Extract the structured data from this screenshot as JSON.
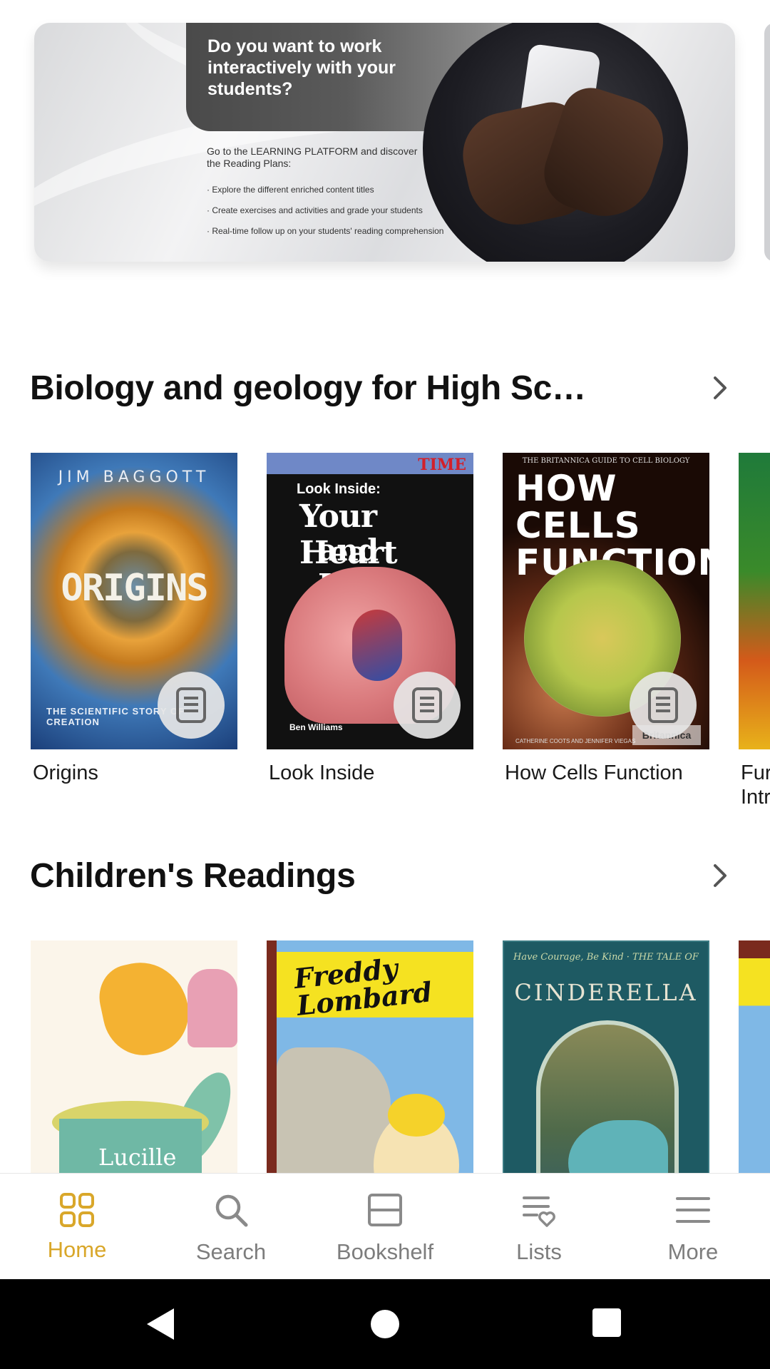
{
  "banner": {
    "headline": "Do you want to work interactively with your students?",
    "subtitle": "Go to the LEARNING PLATFORM and discover the Reading Plans:",
    "bullets": [
      "· Explore the different enriched content titles",
      "· Create exercises and activities and grade your students",
      "· Real-time follow up on your students' reading comprehension"
    ]
  },
  "sections": [
    {
      "title": "Biology and geology for High Sc…",
      "books": [
        {
          "label": "Origins",
          "cover": {
            "author": "JIM BAGGOTT",
            "title": "ORIGINS",
            "subtitle": "THE SCIENTIFIC STORY OF CREATION"
          }
        },
        {
          "label": "Look Inside",
          "cover": {
            "brand": "TIME",
            "kicker": "Look Inside:",
            "title_line1": "Your Heart",
            "title_line2": "and Lungs",
            "author": "Ben Williams"
          }
        },
        {
          "label": "How Cells Function",
          "cover": {
            "series": "THE BRITANNICA GUIDE TO CELL BIOLOGY",
            "title": "HOW CELLS FUNCTION",
            "authors": "CATHERINE COOTS AND JENNIFER VIEGAS",
            "publisher": "Britannica"
          }
        },
        {
          "label": "Fur Intr"
        }
      ]
    },
    {
      "title": "Children's Readings",
      "books": [
        {
          "cover": {
            "title": "Lucille Cooks"
          }
        },
        {
          "cover": {
            "title": "Freddy Lombard"
          }
        },
        {
          "cover": {
            "tagline": "Have Courage, Be Kind · THE TALE OF",
            "title": "CINDERELLA"
          }
        },
        {}
      ]
    }
  ],
  "bottom_nav": {
    "items": [
      {
        "label": "Home",
        "icon": "home-grid-icon",
        "active": true
      },
      {
        "label": "Search",
        "icon": "search-icon",
        "active": false
      },
      {
        "label": "Bookshelf",
        "icon": "bookshelf-icon",
        "active": false
      },
      {
        "label": "Lists",
        "icon": "lists-icon",
        "active": false
      },
      {
        "label": "More",
        "icon": "menu-icon",
        "active": false
      }
    ],
    "active_color": "#d9a72a",
    "inactive_color": "#7d7d7d"
  },
  "system_nav": {
    "buttons": [
      "back",
      "home",
      "recents"
    ]
  }
}
